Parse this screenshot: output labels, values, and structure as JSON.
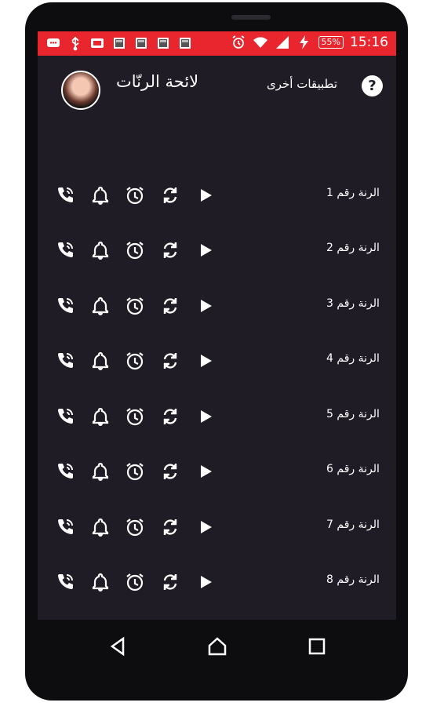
{
  "status_bar": {
    "battery": "55%",
    "time": "15:16",
    "left_icons": [
      "message-icon",
      "usb-icon",
      "sd-card-icon",
      "image-icon",
      "image-icon",
      "image-icon",
      "image-icon"
    ],
    "right_icons": [
      "alarm-icon",
      "wifi-icon",
      "signal-icon",
      "charging-icon"
    ]
  },
  "app_bar": {
    "title": "لائحة الرنّات",
    "other_apps": "تطبيقات أخرى",
    "help": "?"
  },
  "ringtones": [
    {
      "label": "الرنة رقم 1"
    },
    {
      "label": "الرنة رقم 2"
    },
    {
      "label": "الرنة رقم 3"
    },
    {
      "label": "الرنة رقم 4"
    },
    {
      "label": "الرنة رقم 5"
    },
    {
      "label": "الرنة رقم 6"
    },
    {
      "label": "الرنة رقم 7"
    },
    {
      "label": "الرنة رقم 8"
    }
  ],
  "row_actions": [
    "set-call-ringtone-icon",
    "set-notification-icon",
    "set-alarm-icon",
    "repeat-icon",
    "play-icon"
  ],
  "nav_bar": [
    "back-icon",
    "home-icon",
    "recents-icon"
  ],
  "colors": {
    "status_bar": "#e9262e",
    "background": "#201c25",
    "icon": "#ffffff"
  }
}
